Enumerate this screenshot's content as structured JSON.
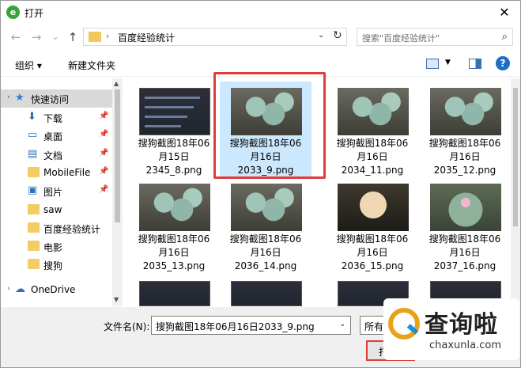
{
  "window": {
    "title": "打开",
    "app_icon_glyph": "e",
    "close_glyph": "✕"
  },
  "nav": {
    "back_glyph": "←",
    "forward_glyph": "→",
    "history_glyph": "⌄",
    "up_glyph": "↑",
    "address_sep": "›",
    "address_path": "百度经验统计",
    "address_drop": "⌄",
    "refresh_glyph": "↻",
    "search_placeholder": "搜索\"百度经验统计\"",
    "search_glyph": "⌕"
  },
  "toolbar": {
    "organize_label": "组织 ▾",
    "new_folder_label": "新建文件夹",
    "view_drop": "▼",
    "help_glyph": "?"
  },
  "sidebar": {
    "items": [
      {
        "label": "快速访问",
        "icon": "star-icon",
        "glyph": "★",
        "pinned": false,
        "active": true
      },
      {
        "label": "下载",
        "icon": "download-icon",
        "glyph": "⬇",
        "pinned": true
      },
      {
        "label": "桌面",
        "icon": "desktop-icon",
        "glyph": "▭",
        "pinned": true
      },
      {
        "label": "文档",
        "icon": "documents-icon",
        "glyph": "▤",
        "pinned": true
      },
      {
        "label": "MobileFile",
        "icon": "folder-icon",
        "glyph": "",
        "pinned": true
      },
      {
        "label": "图片",
        "icon": "pictures-icon",
        "glyph": "▣",
        "pinned": true
      },
      {
        "label": "saw",
        "icon": "folder-icon",
        "glyph": "",
        "pinned": false
      },
      {
        "label": "百度经验统计",
        "icon": "folder-icon",
        "glyph": "",
        "pinned": false
      },
      {
        "label": "电影",
        "icon": "folder-icon",
        "glyph": "",
        "pinned": false
      },
      {
        "label": "搜狗",
        "icon": "folder-icon",
        "glyph": "",
        "pinned": false
      },
      {
        "label": "OneDrive",
        "icon": "cloud-icon",
        "glyph": "☁",
        "pinned": false
      }
    ],
    "caret_glyph": "›",
    "pin_glyph": "📌"
  },
  "files": [
    {
      "line1": "搜狗截图18年06",
      "line2": "月15日",
      "line3": "2345_8.png",
      "thumb": "dark",
      "selected": false
    },
    {
      "line1": "搜狗截图18年06",
      "line2": "月16日",
      "line3": "2033_9.png",
      "thumb": "plant",
      "selected": true
    },
    {
      "line1": "搜狗截图18年06",
      "line2": "月16日",
      "line3": "2034_11.png",
      "thumb": "plant",
      "selected": false
    },
    {
      "line1": "搜狗截图18年06",
      "line2": "月16日",
      "line3": "2035_12.png",
      "thumb": "plant",
      "selected": false
    },
    {
      "line1": "搜狗截图18年06",
      "line2": "月16日",
      "line3": "2035_13.png",
      "thumb": "plant",
      "selected": false
    },
    {
      "line1": "搜狗截图18年06",
      "line2": "月16日",
      "line3": "2036_14.png",
      "thumb": "plant",
      "selected": false
    },
    {
      "line1": "搜狗截图18年06",
      "line2": "月16日",
      "line3": "2036_15.png",
      "thumb": "cactus",
      "selected": false
    },
    {
      "line1": "搜狗截图18年06",
      "line2": "月16日",
      "line3": "2037_16.png",
      "thumb": "pink",
      "selected": false
    }
  ],
  "footer": {
    "filename_label": "文件名(N):",
    "filename_value": "搜狗截图18年06月16日2033_9.png",
    "filter_label": "所有",
    "open_label": "打开",
    "drop_glyph": "⌄"
  },
  "watermark": {
    "text": "查询啦",
    "url": "chaxunla.com"
  },
  "colors": {
    "accent": "#1e6dc7",
    "selection": "#cce8ff",
    "highlight": "#e03c3c"
  }
}
